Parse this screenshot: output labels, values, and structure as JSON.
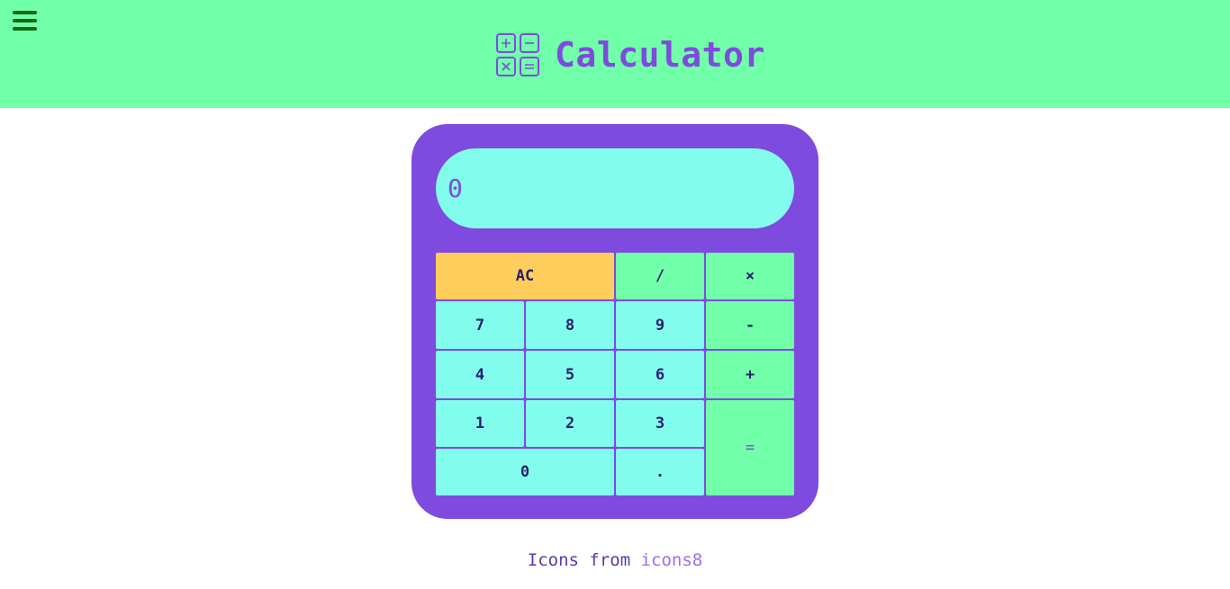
{
  "header": {
    "title": "Calculator",
    "menu_icon": "hamburger-menu-icon",
    "logo_icon": "calculator-icon"
  },
  "display": {
    "value": "0"
  },
  "keys": {
    "clear": "AC",
    "divide": "/",
    "multiply": "×",
    "seven": "7",
    "eight": "8",
    "nine": "9",
    "subtract": "-",
    "four": "4",
    "five": "5",
    "six": "6",
    "add": "+",
    "one": "1",
    "two": "2",
    "three": "3",
    "equals": "=",
    "zero": "0",
    "decimal": "."
  },
  "footer": {
    "text": "Icons from",
    "link": "icons8"
  },
  "colors": {
    "header_bg": "#72ffa9",
    "accent_purple": "#7f4ade",
    "display_bg": "#82fcec",
    "operator_key": "#72ffa9",
    "clear_key": "#ffcd5c"
  }
}
